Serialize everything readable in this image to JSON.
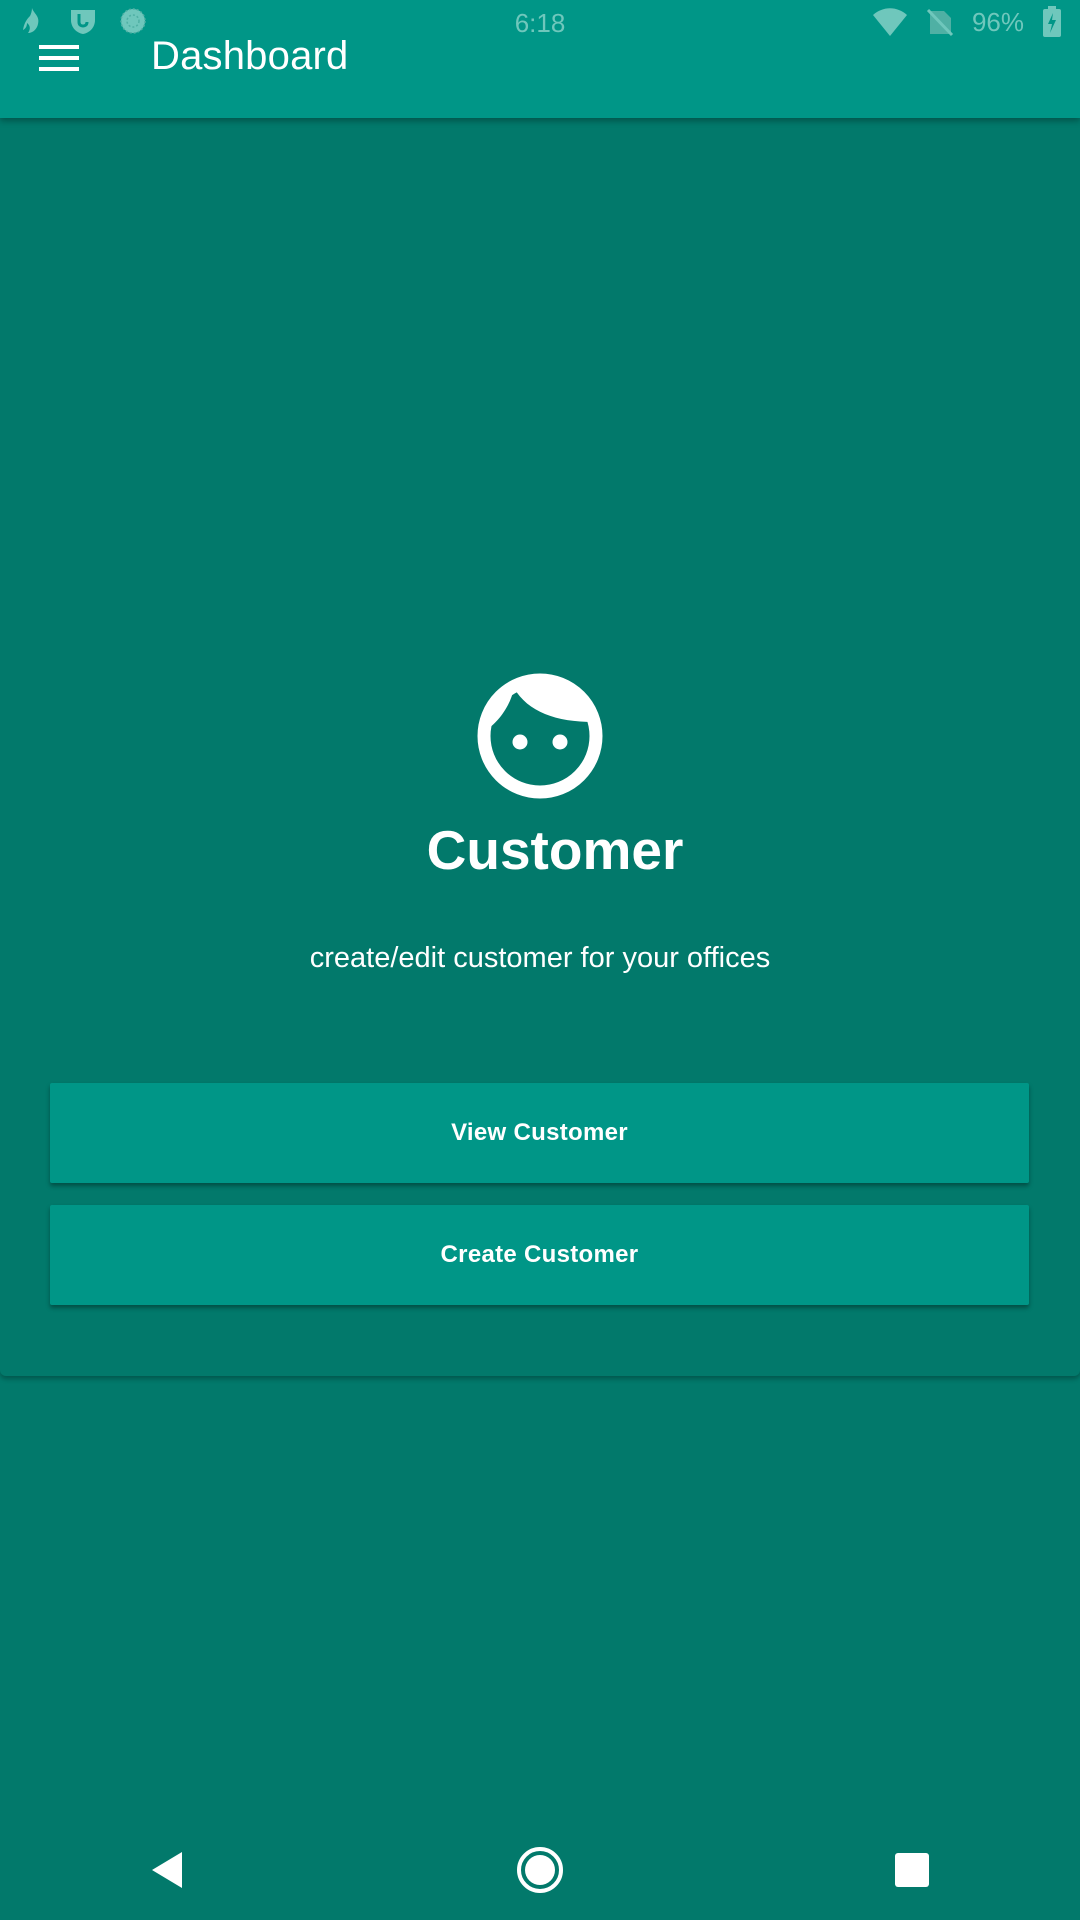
{
  "status_bar": {
    "time": "6:18",
    "battery": "96%",
    "left_icons": [
      "flame-notification-icon",
      "shield-notification-icon",
      "globe-notification-icon"
    ],
    "right_icons": [
      "wifi-icon",
      "no-sim-icon",
      "battery-charging-icon"
    ]
  },
  "app_bar": {
    "title": "Dashboard",
    "menu_icon": "hamburger-menu-icon"
  },
  "card": {
    "icon": "face-icon",
    "title": "Customer",
    "subtitle": "create/edit customer for your offices",
    "buttons": {
      "view": "View Customer",
      "create": "Create Customer"
    }
  },
  "nav_bar": {
    "back": "back-icon",
    "home": "home-icon",
    "recents": "recents-icon"
  },
  "colors": {
    "primary": "#009687",
    "background": "#02796b",
    "text": "#ffffff",
    "status_text": "#6fc7bc"
  }
}
